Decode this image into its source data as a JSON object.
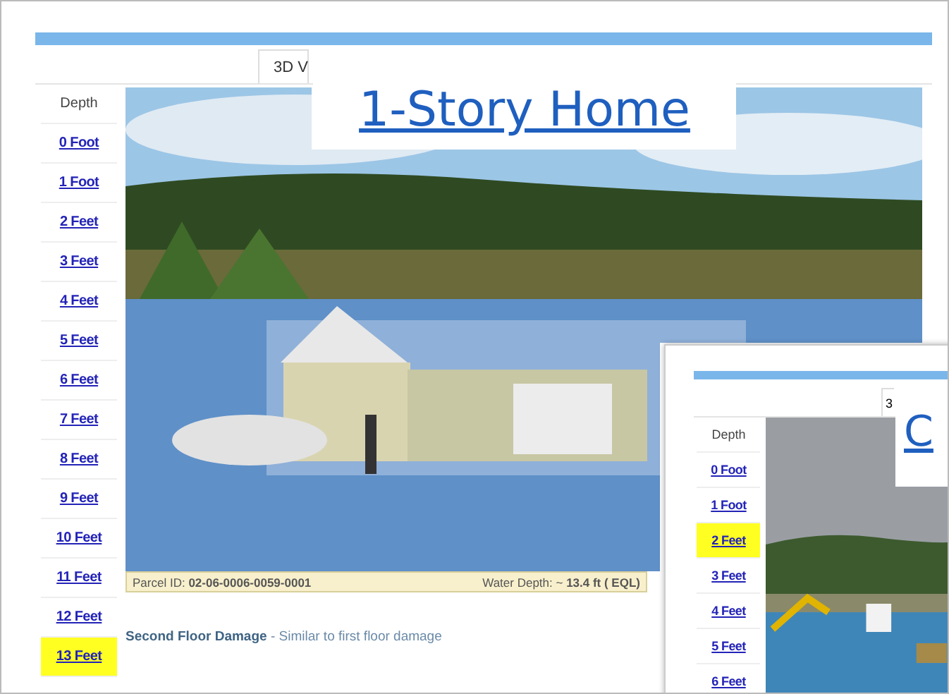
{
  "main_window": {
    "tab": "3D V",
    "depth_header": "Depth",
    "depths": [
      {
        "label": "0 Foot",
        "selected": false
      },
      {
        "label": "1 Foot",
        "selected": false
      },
      {
        "label": "2 Feet",
        "selected": false
      },
      {
        "label": "3 Feet",
        "selected": false
      },
      {
        "label": "4 Feet",
        "selected": false
      },
      {
        "label": "5 Feet",
        "selected": false
      },
      {
        "label": "6 Feet",
        "selected": false
      },
      {
        "label": "7 Feet",
        "selected": false
      },
      {
        "label": "8 Feet",
        "selected": false
      },
      {
        "label": "9 Feet",
        "selected": false
      },
      {
        "label": "10 Feet",
        "selected": false
      },
      {
        "label": "11 Feet",
        "selected": false
      },
      {
        "label": "12 Feet",
        "selected": false
      },
      {
        "label": "13 Feet",
        "selected": true
      }
    ],
    "status_bar": {
      "parcel": "Parcel ID: **02-06-0006-0059-0001**",
      "water_depth": "Water Depth: ~ **13.4 ft ( EQL)**"
    },
    "description": "**Second Floor Damage** - Similar to first floor damage"
  },
  "overlay_label": "1-Story Home",
  "second_window": {
    "tab": "3",
    "overlay_label": "C",
    "depth_header": "Depth",
    "depths": [
      {
        "label": "0 Foot",
        "selected": false
      },
      {
        "label": "1 Foot",
        "selected": false
      },
      {
        "label": "2 Feet",
        "selected": true
      },
      {
        "label": "3 Feet",
        "selected": false
      },
      {
        "label": "4 Feet",
        "selected": false
      },
      {
        "label": "5 Feet",
        "selected": false
      },
      {
        "label": "6 Feet",
        "selected": false
      }
    ]
  }
}
